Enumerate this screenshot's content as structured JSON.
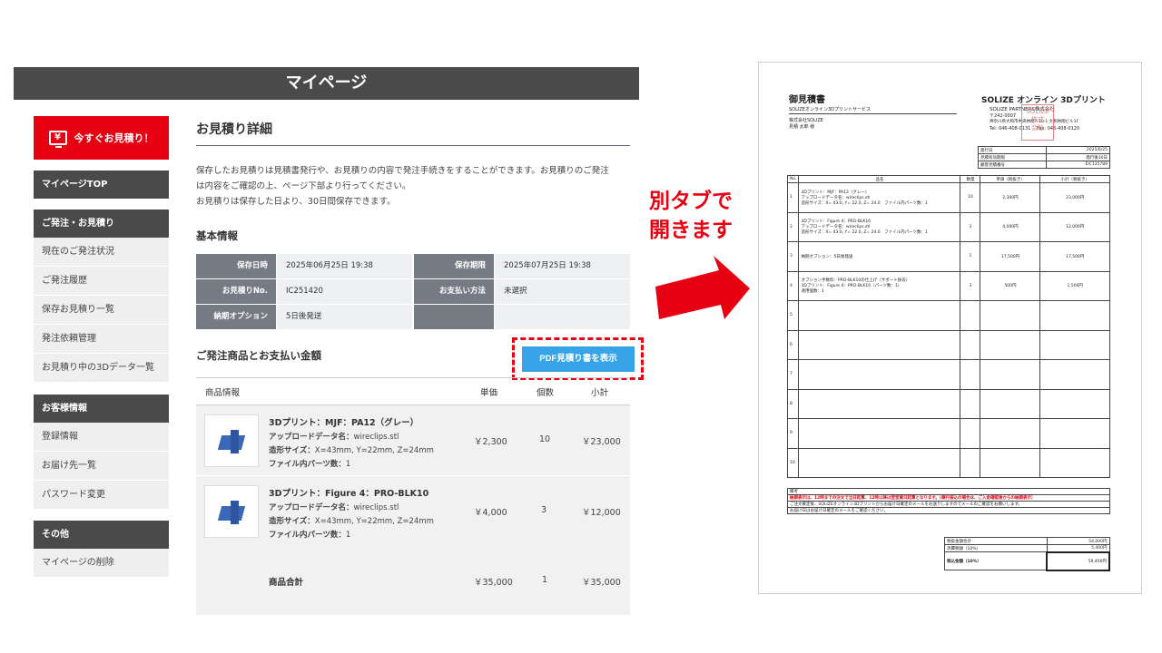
{
  "header": {
    "title": "マイページ"
  },
  "sidebar": {
    "quote_button": "今すぐお見積り！",
    "quote_icon": "¥",
    "top_label": "マイページTOP",
    "sections": [
      {
        "title": "ご発注・お見積り",
        "items": [
          "現在のご発注状況",
          "ご発注履歴",
          "保存お見積り一覧",
          "発注依頼管理",
          "お見積り中の3Dデータ一覧"
        ]
      },
      {
        "title": "お客様情報",
        "items": [
          "登録情報",
          "お届け先一覧",
          "パスワード変更"
        ]
      },
      {
        "title": "その他",
        "items": [
          "マイページの削除"
        ]
      }
    ]
  },
  "main": {
    "title": "お見積り詳細",
    "desc": [
      "保存したお見積りは見積書発行や、お見積りの内容で発注手続きをすることができます。お見積りのご発注",
      "は内容をご確認の上、ページ下部より行ってください。",
      "お見積りは保存した日より、30日間保存できます。"
    ],
    "basic_title": "基本情報",
    "basic": {
      "saved_at_label": "保存日時",
      "saved_at": "2025年06月25日 19:38",
      "expire_label": "保存期限",
      "expire": "2025年07月25日 19:38",
      "quote_no_label": "お見積りNo.",
      "quote_no": "IC251420",
      "payment_label": "お支払い方法",
      "payment": "未選択",
      "delivery_label": "納期オプション",
      "delivery": "5日後発送"
    },
    "products_title": "ご発注商品とお支払い金額",
    "pdf_button": "PDF見積り書を表示",
    "columns": {
      "info": "商品情報",
      "price": "単価",
      "qty": "個数",
      "subtotal": "小計"
    },
    "products": [
      {
        "name": "3Dプリント：MJF：PA12（グレー）",
        "data_label": "アップロードデータ名：",
        "data": "wireclips.stl",
        "size_label": "造形サイズ：",
        "size": "X=43mm, Y=22mm, Z=24mm",
        "parts_label": "ファイル内パーツ数：",
        "parts": "1",
        "price": "￥2,300",
        "qty": "10",
        "subtotal": "￥23,000"
      },
      {
        "name": "3Dプリント：Figure 4：PRO-BLK10",
        "data_label": "アップロードデータ名：",
        "data": "wireclips.stl",
        "size_label": "造形サイズ：",
        "size": "X=43mm, Y=22mm, Z=24mm",
        "parts_label": "ファイル内パーツ数：",
        "parts": "1",
        "price": "￥4,000",
        "qty": "3",
        "subtotal": "￥12,000"
      }
    ],
    "total": {
      "label": "商品合計",
      "price": "￥35,000",
      "qty": "1",
      "subtotal": "￥35,000"
    }
  },
  "callout": {
    "line1": "別タブで",
    "line2": "開きます"
  },
  "pdf": {
    "title": "御見積書",
    "service": "SOLIZEオンライン3Dプリントサービス",
    "company": "株式会社SOLIZE",
    "recipient": "見積 太郎 様",
    "brand": "SOLIZE オンライン 3Dプリント",
    "issuer": "SOLIZE PARTNERS株式会社",
    "zip": "〒242-0007",
    "address": "神奈川県大和市中央林間7-10-1 大和林間ビル1F",
    "tel": "Tel: 046-408-0131",
    "fax": "Fax: 046-408-0120",
    "stamp": "SOLIZE株式会社",
    "meta": [
      {
        "k": "発行日",
        "v": "2025/6/25"
      },
      {
        "k": "見積有効期限",
        "v": "発行後30日"
      },
      {
        "k": "顧客見積番号",
        "v": "EIC135789"
      }
    ],
    "head": {
      "no": "No.",
      "name": "品名",
      "qty": "数量",
      "unit": "単価（税抜き）",
      "sub": "小計（税抜き）"
    },
    "rows": [
      {
        "no": "1",
        "lines": [
          "3Dプリント：MJF：PA12（グレー）",
          "アップロードデータ名：wireclips.stl",
          "造形サイズ：X= 43.0, Y= 22.0, Z= 24.0　ファイル内パーツ数：1"
        ],
        "qty": "10",
        "unit": "2,300円",
        "sub": "23,000円"
      },
      {
        "no": "2",
        "lines": [
          "3Dプリント：Figure 4：PRO-BLK10",
          "アップロードデータ名：wireclips.stl",
          "造形サイズ：X= 43.0, Y= 22.0, Z= 24.0　ファイル内パーツ数：1"
        ],
        "qty": "3",
        "unit": "4,000円",
        "sub": "12,000円"
      },
      {
        "no": "3",
        "lines": [
          "納期オプション：5日後発送"
        ],
        "qty": "1",
        "unit": "17,500円",
        "sub": "17,500円"
      },
      {
        "no": "4",
        "lines": [
          "オプション手数料：PRO-BLK10の仕上げ（サポート除去）",
          "3Dプリント：Figure 4：PRO-BLK10（パーツ数：1）",
          "適用個数：1"
        ],
        "qty": "3",
        "unit": "500円",
        "sub": "1,500円"
      },
      {
        "no": "5",
        "lines": [],
        "qty": "",
        "unit": "",
        "sub": ""
      },
      {
        "no": "6",
        "lines": [],
        "qty": "",
        "unit": "",
        "sub": ""
      },
      {
        "no": "7",
        "lines": [],
        "qty": "",
        "unit": "",
        "sub": ""
      },
      {
        "no": "8",
        "lines": [],
        "qty": "",
        "unit": "",
        "sub": ""
      },
      {
        "no": "9",
        "lines": [],
        "qty": "",
        "unit": "",
        "sub": ""
      },
      {
        "no": "10",
        "lines": [],
        "qty": "",
        "unit": "",
        "sub": ""
      }
    ],
    "remarks_title": "備考",
    "remarks": [
      "納期表示は、12時までの注文で当日起算、12時以降は翌営業日起算となります。(銀行振込の場合は、ご入金確認後からの納期表示）",
      "ご注文確定後、SOLIZEオンライン3Dプリントからお届け日確定のメールをお送りしますのでメールのご確認をお願いします。",
      "お届け日はお届け日確定のメールをご確認ください。"
    ],
    "totals": [
      {
        "k": "税抜金額合計",
        "v": "54,000円"
      },
      {
        "k": "消費税額（10%）",
        "v": "5,400円"
      },
      {
        "k": "税込金額（10%）",
        "v": "59,400円"
      }
    ]
  },
  "colors": {
    "accent_red": "#e60012",
    "button_blue": "#36a4e6",
    "header_gray": "#4a4a4a"
  }
}
